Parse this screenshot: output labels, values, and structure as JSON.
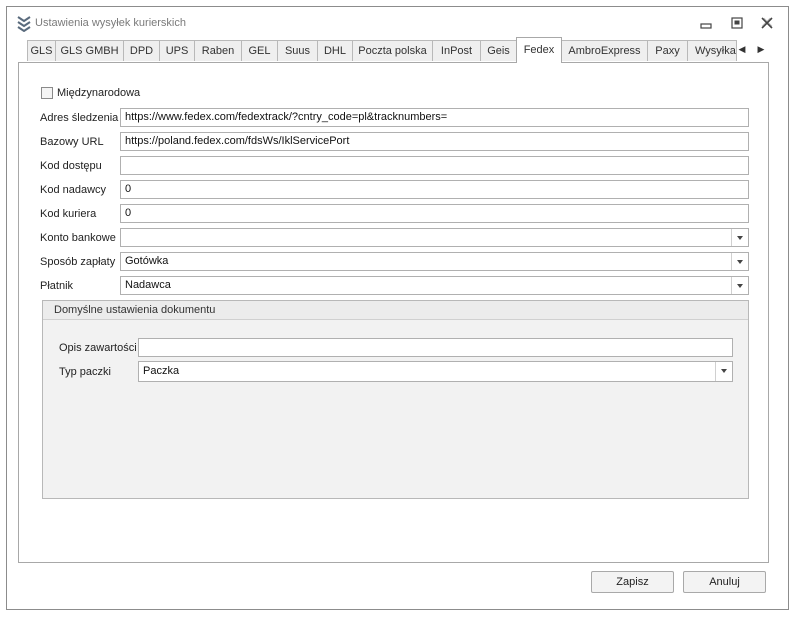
{
  "window": {
    "title": "Ustawienia wysyłek kurierskich"
  },
  "tabs": [
    {
      "label": "GLS"
    },
    {
      "label": "GLS GMBH"
    },
    {
      "label": "DPD"
    },
    {
      "label": "UPS"
    },
    {
      "label": "Raben"
    },
    {
      "label": "GEL"
    },
    {
      "label": "Suus"
    },
    {
      "label": "DHL"
    },
    {
      "label": "Poczta polska"
    },
    {
      "label": "InPost"
    },
    {
      "label": "Geis"
    },
    {
      "label": "Fedex"
    },
    {
      "label": "AmbroExpress"
    },
    {
      "label": "Paxy"
    },
    {
      "label": "Wysyłka"
    }
  ],
  "active_tab": "Fedex",
  "form": {
    "international_label": "Międzynarodowa",
    "international_checked": false,
    "tracking_label": "Adres śledzenia",
    "tracking_value": "https://www.fedex.com/fedextrack/?cntry_code=pl&tracknumbers=",
    "base_url_label": "Bazowy URL",
    "base_url_value": "https://poland.fedex.com/fdsWs/IklServicePort",
    "access_code_label": "Kod dostępu",
    "access_code_value": "",
    "sender_code_label": "Kod nadawcy",
    "sender_code_value": "0",
    "courier_code_label": "Kod kuriera",
    "courier_code_value": "0",
    "bank_account_label": "Konto bankowe",
    "bank_account_value": "",
    "payment_method_label": "Sposób zapłaty",
    "payment_method_value": "Gotówka",
    "payer_label": "Płatnik",
    "payer_value": "Nadawca"
  },
  "document_defaults": {
    "title": "Domyślne ustawienia dokumentu",
    "contents_label": "Opis zawartości",
    "contents_value": "",
    "package_type_label": "Typ paczki",
    "package_type_value": "Paczka"
  },
  "buttons": {
    "save": "Zapisz",
    "cancel": "Anuluj"
  },
  "colors": {
    "app_icon": "#5a6b7d"
  }
}
